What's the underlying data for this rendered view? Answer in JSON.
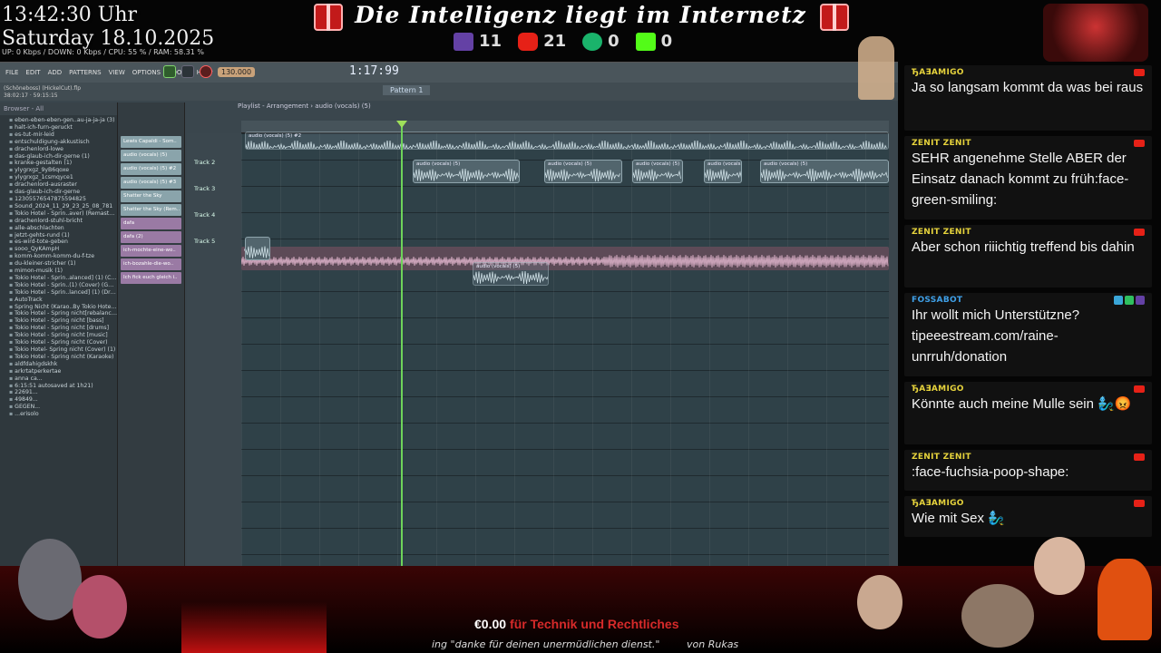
{
  "overlay": {
    "time": "13:42:30 Uhr",
    "date": "Saturday 18.10.2025",
    "net_stats": "UP: 0 Kbps / DOWN: 0 Kbps / CPU: 55 % / RAM: 58.31 %",
    "banner_title": "Die Intelligenz liegt im Internetz",
    "counters": {
      "twitch": "11",
      "youtube": "21",
      "trovo": "0",
      "kick": "0"
    },
    "donation_amount": "€0.00",
    "donation_label": "für Technik und Rechtliches",
    "ticker_left": "ing \"danke für deinen unermüdlichen dienst.\"",
    "ticker_right": "von Rukas"
  },
  "daw": {
    "menu": [
      "FILE",
      "EDIT",
      "ADD",
      "PATTERNS",
      "VIEW",
      "OPTIONS",
      "TOOLS",
      "HELP"
    ],
    "bpm": "130.000",
    "timecode": "1:17:99",
    "pattern": "Pattern 1",
    "project_info": [
      "(Schöneboss) (HickelCut).flp",
      "38:02:17 · 59:15:15"
    ],
    "playlist_title": "Playlist - Arrangement › audio (vocals) (5)",
    "browser_header": "Browser - All",
    "browser_items": [
      "eben-eben-eben-gen..au-ja-ja-ja (3)",
      "halt-ich-furn-geruckt",
      "es-tut-mir-leid",
      "entschuldigung-akkustisch",
      "drachenlord-lowe",
      "das-glaub-ich-dir-gerne (1)",
      "kranke-gestalten (1)",
      "ylygrxgz_9yB6qoxe",
      "ylygrxgz_1csmqyce1",
      "drachenlord-ausraster",
      "das-glaub-ich-dir-gerne",
      "12305576547875594825",
      "Sound_2024_11_29_23_25_08_781",
      "Tokio Hotel - Sprin..aver) (Remastered)",
      "drachenlord-stuhl-bricht",
      "alle-abschlachten",
      "jetzt-gehts-rund (1)",
      "es-wird-tote-geben",
      "sooo_QyKAmpH",
      "komm-komm-komm-du-f-tze",
      "du-kleiner-stricher (1)",
      "mimon-musik (1)",
      "Tokio Hotel - Sprin..alanced] (1) (Cover)",
      "Tokio Hotel - Sprin..(1) (Cover) (Guitar)",
      "Tokio Hotel - Sprin..lanced] (1) (Drums)",
      "AutoTrack",
      "Spring Nicht (Karao..By Tokio Hotel) (1)",
      "Tokio Hotel - Spring nicht[rebalanced]",
      "Tokio Hotel - Spring nicht [bass]",
      "Tokio Hotel - Spring nicht [drums]",
      "Tokio Hotel - Spring nicht [music]",
      "Tokio Hotel - Spring nicht (Cover)",
      "Tokio Hotel- Spring nicht (Cover) (1)",
      "Tokio Hotel - Spring nicht (Karaoke)",
      "aldfdahigdskhk",
      "arkrtatperkertae",
      "anna ca...",
      "6:15:51 autosaved at 1h21)",
      "22691...",
      "49849...",
      "GEGEN...",
      "...erisolo"
    ],
    "channels": [
      "Lewis Capaldi - Som..",
      "audio (vocals) (5)",
      "audio (vocals) (5) #2",
      "audio (vocals) (5) #3",
      "Shatter the Sky",
      "Shatter the Sky (Rem..",
      "dafa",
      "dafa (2)",
      "ich-mochte-eine-wo..",
      "ich-bozahle-die-wo..",
      "Ich fick euch gleich i.."
    ],
    "tracks": [
      "Track 2",
      "Track 3",
      "Track 4",
      "Track 5"
    ],
    "clips": {
      "top": "audio (vocals) (5) #2",
      "vocals": "audio (vocals) (5)",
      "dafa": "dafa",
      "ghost": "audio (vocals) (5)"
    }
  },
  "chat": [
    {
      "user": "ЂAƎAMIGO",
      "user_color": "#e6d33c",
      "text": "Ja so langsam kommt da was bei raus",
      "platform": "youtube"
    },
    {
      "user": "ZENIT ZENIT",
      "user_color": "#e6d33c",
      "text": "SEHR angenehme Stelle ABER der Einsatz danach kommt zu früh:face-green-smiling:",
      "platform": "youtube"
    },
    {
      "user": "ZENIT ZENIT",
      "user_color": "#e6d33c",
      "text": "Aber schon riiichtig treffend bis dahin",
      "platform": "youtube"
    },
    {
      "user": "FOSSABOT",
      "user_color": "#3fa0e8",
      "text": "Ihr wollt mich Unterstützne? tipeeestream.com/raine-unrruh/donation",
      "platform": "twitch"
    },
    {
      "user": "ЂAƎAMIGO",
      "user_color": "#e6d33c",
      "text": "Könnte auch meine Mulle sein 🧞‍♂️😡",
      "platform": "youtube"
    },
    {
      "user": "ZENIT ZENIT",
      "user_color": "#e6d33c",
      "text": ":face-fuchsia-poop-shape:",
      "platform": "youtube"
    },
    {
      "user": "ЂAƎAMIGO",
      "user_color": "#e6d33c",
      "text": "Wie mit Sex 🧞‍♂️",
      "platform": "youtube"
    }
  ]
}
